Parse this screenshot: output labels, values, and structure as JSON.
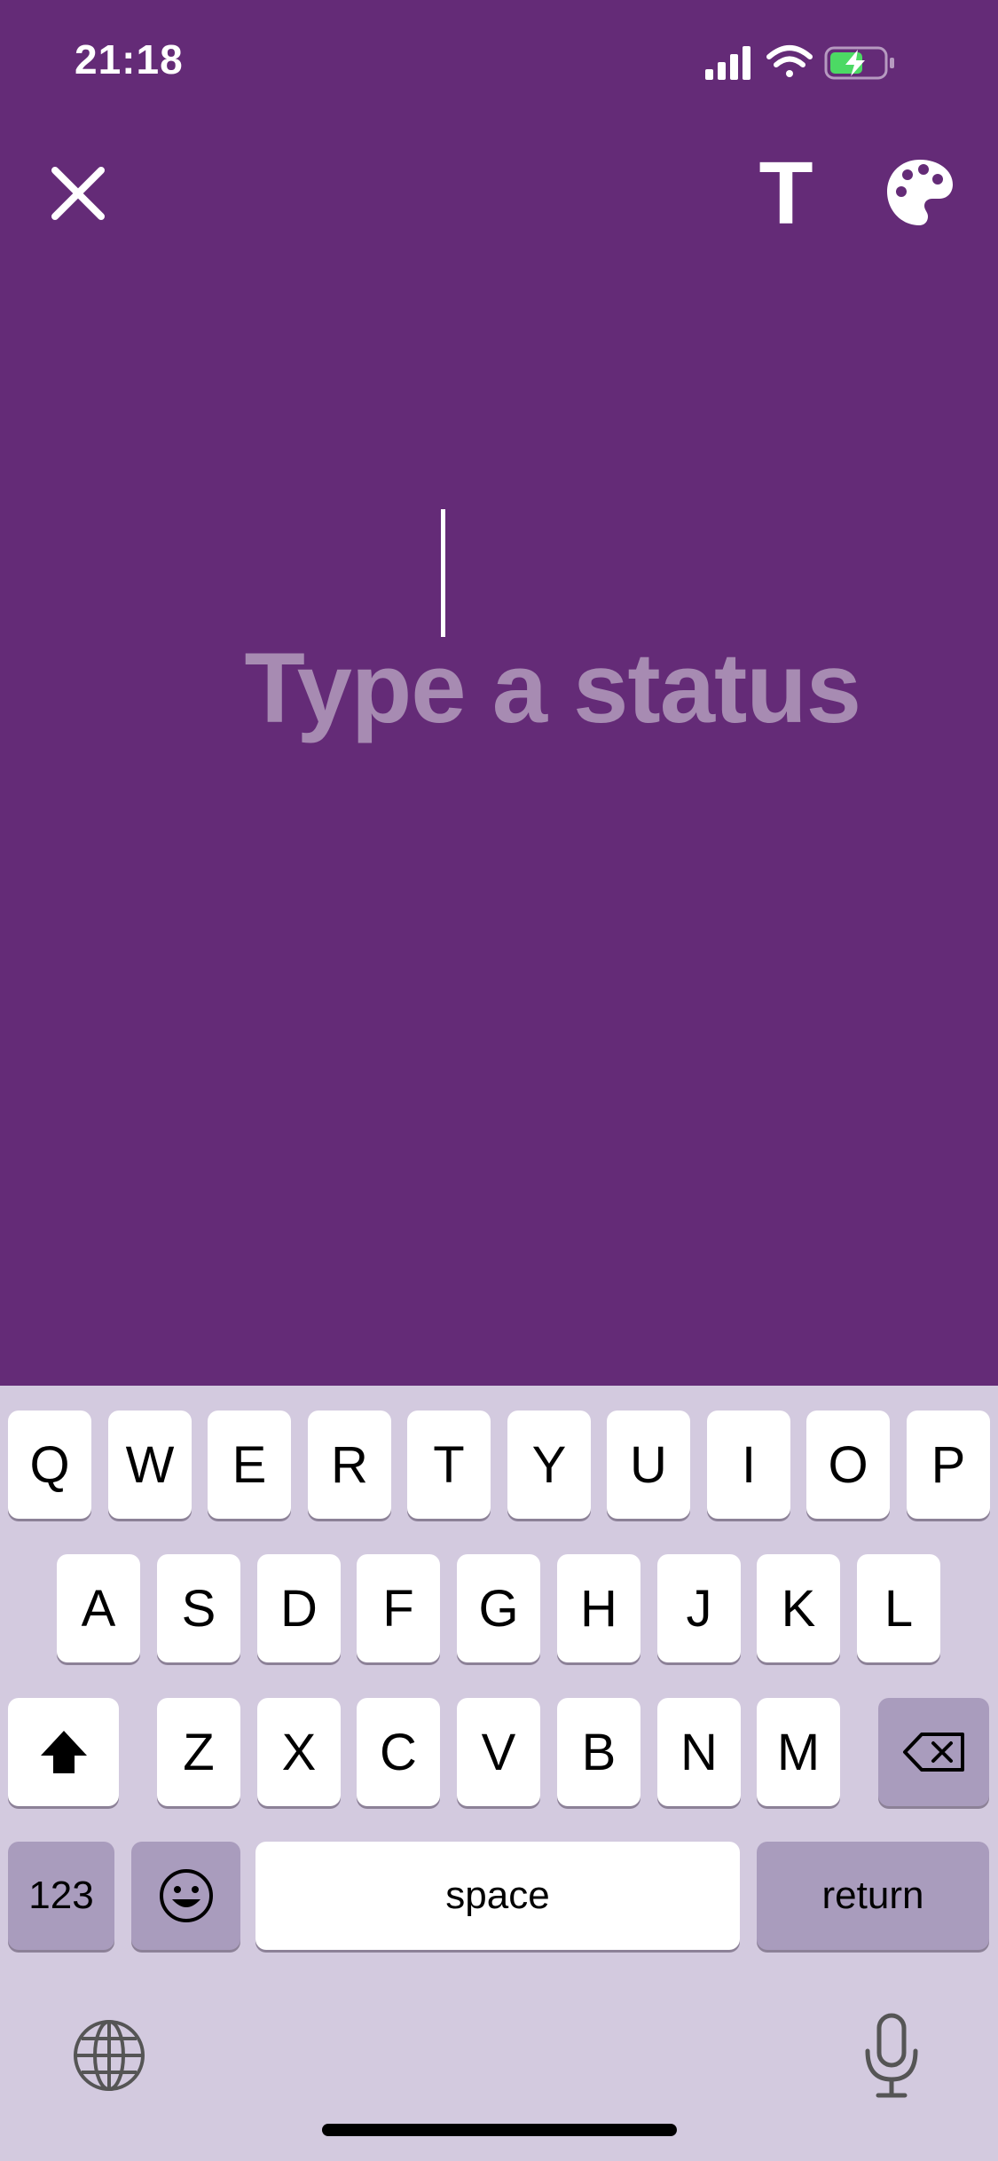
{
  "status_bar": {
    "time": "21:18",
    "icons": [
      "cellular-signal-icon",
      "wifi-icon",
      "battery-charging-icon"
    ]
  },
  "toolbar": {
    "close_icon": "close-icon",
    "text_style_label": "T",
    "palette_icon": "palette-icon"
  },
  "composer": {
    "placeholder": "Type a status",
    "background_color": "#642b77"
  },
  "keyboard": {
    "row1": [
      "Q",
      "W",
      "E",
      "R",
      "T",
      "Y",
      "U",
      "I",
      "O",
      "P"
    ],
    "row2": [
      "A",
      "S",
      "D",
      "F",
      "G",
      "H",
      "J",
      "K",
      "L"
    ],
    "row3": [
      "Z",
      "X",
      "C",
      "V",
      "B",
      "N",
      "M"
    ],
    "numbers_label": "123",
    "space_label": "space",
    "return_label": "return",
    "shift_icon": "shift-icon",
    "delete_icon": "delete-icon",
    "emoji_icon": "emoji-icon",
    "globe_icon": "globe-icon",
    "mic_icon": "microphone-icon"
  }
}
